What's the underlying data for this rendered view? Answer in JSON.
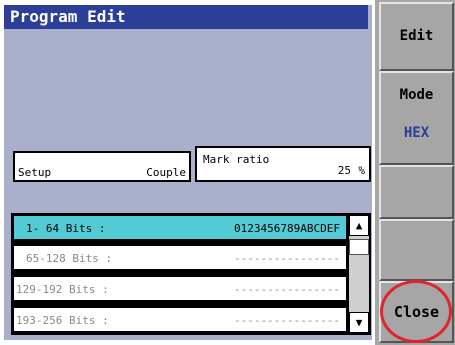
{
  "title": "Program Edit",
  "setup": {
    "label": "Setup",
    "value": "Couple"
  },
  "mark_ratio": {
    "label": "Mark ratio",
    "value": "25",
    "unit": "%"
  },
  "bits_list": {
    "rows": [
      {
        "label": "1- 64 Bits :",
        "value": "0123456789ABCDEF",
        "selected": true
      },
      {
        "label": "65-128 Bits :",
        "value": "----------------",
        "selected": false
      },
      {
        "label": "129-192 Bits :",
        "value": "----------------",
        "selected": false
      },
      {
        "label": "193-256 Bits :",
        "value": "----------------",
        "selected": false
      }
    ]
  },
  "softkeys": {
    "edit": "Edit",
    "mode_label": "Mode",
    "mode_value": "HEX",
    "close": "Close"
  },
  "colors": {
    "title_bar": "#2c3f98",
    "panel_bg": "#aab0cc",
    "selected_row": "#53cbd4",
    "softkey_bg": "#a6a6a6",
    "mode_value": "#2c3f98",
    "highlight_ring": "#e0242c"
  },
  "icons": {
    "scroll_up": "triangle-up",
    "scroll_down": "triangle-down"
  }
}
